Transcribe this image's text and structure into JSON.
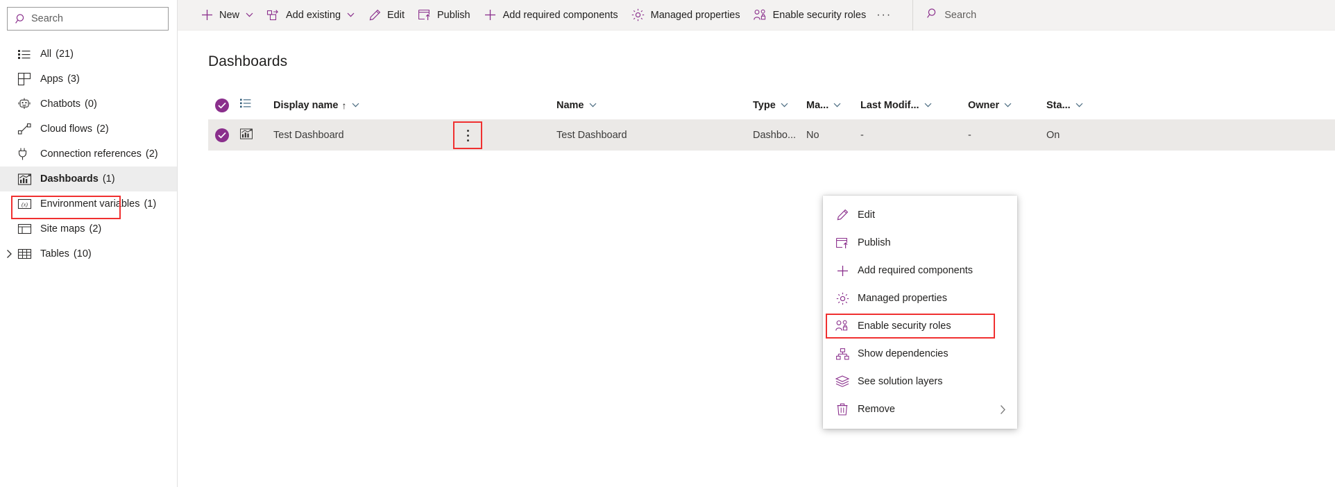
{
  "sidebar": {
    "search": {
      "placeholder": "Search",
      "icon": "search-icon"
    },
    "items": [
      {
        "label": "All",
        "count": "(21)",
        "icon": "list-icon",
        "selected": false,
        "expandable": false
      },
      {
        "label": "Apps",
        "count": "(3)",
        "icon": "apps-grid-icon",
        "selected": false,
        "expandable": false
      },
      {
        "label": "Chatbots",
        "count": "(0)",
        "icon": "chatbot-icon",
        "selected": false,
        "expandable": false
      },
      {
        "label": "Cloud flows",
        "count": "(2)",
        "icon": "cloud-flow-icon",
        "selected": false,
        "expandable": false
      },
      {
        "label": "Connection references",
        "count": "(2)",
        "icon": "plug-icon",
        "selected": false,
        "expandable": false
      },
      {
        "label": "Dashboards",
        "count": "(1)",
        "icon": "dashboard-chart-icon",
        "selected": true,
        "expandable": false
      },
      {
        "label": "Environment variables",
        "count": "(1)",
        "icon": "variable-icon",
        "selected": false,
        "expandable": false
      },
      {
        "label": "Site maps",
        "count": "(2)",
        "icon": "sitemap-layout-icon",
        "selected": false,
        "expandable": false
      },
      {
        "label": "Tables",
        "count": "(10)",
        "icon": "table-grid-icon",
        "selected": false,
        "expandable": true
      }
    ]
  },
  "toolbar": {
    "items": [
      {
        "label": "New",
        "icon": "plus-icon",
        "caret": true
      },
      {
        "label": "Add existing",
        "icon": "add-existing-icon",
        "caret": true
      },
      {
        "label": "Edit",
        "icon": "pencil-icon",
        "caret": false
      },
      {
        "label": "Publish",
        "icon": "publish-icon",
        "caret": false
      },
      {
        "label": "Add required components",
        "icon": "plus-icon",
        "caret": false
      },
      {
        "label": "Managed properties",
        "icon": "gear-icon",
        "caret": false
      },
      {
        "label": "Enable security roles",
        "icon": "security-roles-icon",
        "caret": false
      }
    ],
    "overflow_label": "···",
    "search": {
      "label": "Search",
      "icon": "search-icon"
    }
  },
  "page": {
    "title": "Dashboards"
  },
  "table": {
    "columns": [
      {
        "key": "display_name",
        "label": "Display name",
        "sorted": "↑",
        "caret": true
      },
      {
        "key": "name",
        "label": "Name",
        "sorted": "",
        "caret": true
      },
      {
        "key": "type",
        "label": "Type",
        "sorted": "",
        "caret": true
      },
      {
        "key": "managed",
        "label": "Ma...",
        "sorted": "",
        "caret": true
      },
      {
        "key": "last_modified",
        "label": "Last Modif...",
        "sorted": "",
        "caret": true
      },
      {
        "key": "owner",
        "label": "Owner",
        "sorted": "",
        "caret": true
      },
      {
        "key": "status",
        "label": "Sta...",
        "sorted": "",
        "caret": true
      }
    ],
    "header_icons": {
      "select_all": "check-circle-filled-icon",
      "row_type": "list-icon"
    },
    "rows": [
      {
        "selected": true,
        "row_icon": "dashboard-chart-icon",
        "display_name": "Test Dashboard",
        "name": "Test Dashboard",
        "type": "Dashbo...",
        "managed": "No",
        "last_modified": "-",
        "owner": "-",
        "status": "On",
        "more_icon": "more-vertical-icon"
      }
    ]
  },
  "context_menu": {
    "items": [
      {
        "label": "Edit",
        "icon": "pencil-icon",
        "submenu": false,
        "highlighted": false
      },
      {
        "label": "Publish",
        "icon": "publish-icon",
        "submenu": false,
        "highlighted": false
      },
      {
        "label": "Add required components",
        "icon": "plus-icon",
        "submenu": false,
        "highlighted": false
      },
      {
        "label": "Managed properties",
        "icon": "gear-icon",
        "submenu": false,
        "highlighted": false
      },
      {
        "label": "Enable security roles",
        "icon": "security-roles-icon",
        "submenu": false,
        "highlighted": true
      },
      {
        "label": "Show dependencies",
        "icon": "show-dependencies-icon",
        "submenu": false,
        "highlighted": false
      },
      {
        "label": "See solution layers",
        "icon": "solution-layers-icon",
        "submenu": false,
        "highlighted": false
      },
      {
        "label": "Remove",
        "icon": "trash-icon",
        "submenu": true,
        "highlighted": false
      }
    ]
  },
  "colors": {
    "accent_purple": "#8a2f8c",
    "highlight_red": "#f03030",
    "toolbar_bg": "#f3f2f1",
    "row_selected_bg": "#ebe9e7",
    "sidebar_selected_bg": "#ededed"
  }
}
